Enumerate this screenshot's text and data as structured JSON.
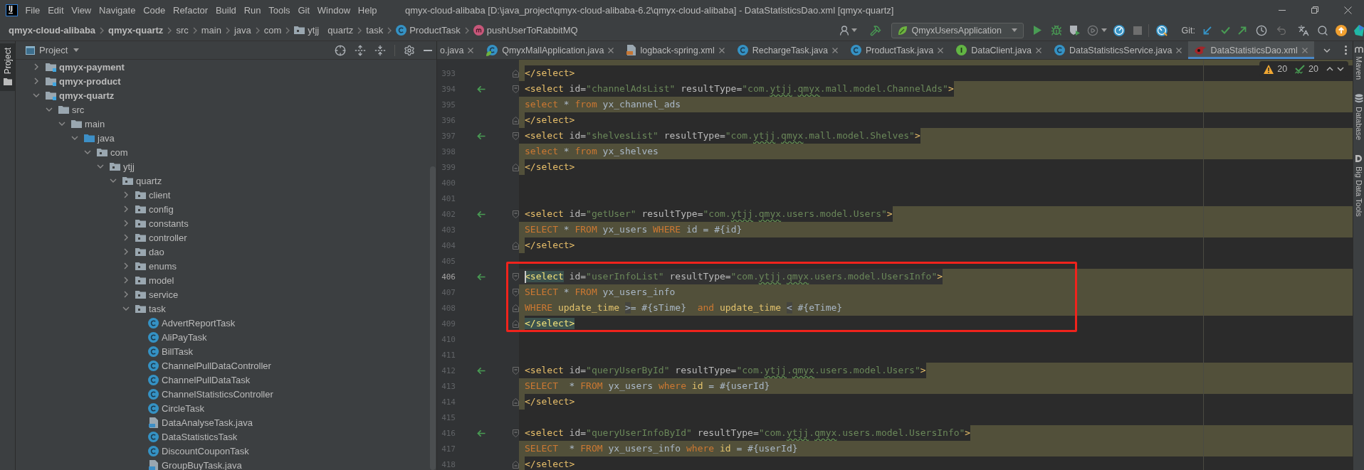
{
  "window": {
    "logo": "IJ",
    "title": "qmyx-cloud-alibaba [D:\\java_project\\qmyx-cloud-alibaba-6.2\\qmyx-cloud-alibaba] - DataStatisticsDao.xml [qmyx-quartz]"
  },
  "menu": [
    "File",
    "Edit",
    "View",
    "Navigate",
    "Code",
    "Refactor",
    "Build",
    "Run",
    "Tools",
    "Git",
    "Window",
    "Help"
  ],
  "breadcrumbs": [
    {
      "label": "qmyx-cloud-alibaba",
      "kind": "module",
      "chevron": true
    },
    {
      "label": "qmyx-quartz",
      "kind": "module",
      "chevron": true
    },
    {
      "label": "src",
      "kind": "directory",
      "chevron": true
    },
    {
      "label": "main",
      "kind": "directory",
      "chevron": true
    },
    {
      "label": "java",
      "kind": "directory",
      "chevron": true
    },
    {
      "label": "com",
      "kind": "directory",
      "chevron": true
    },
    {
      "label": "ytjj",
      "kind": "package",
      "chevron": false
    },
    {
      "label": "quartz",
      "kind": "directory",
      "chevron": true
    },
    {
      "label": "task",
      "kind": "directory",
      "chevron": true
    },
    {
      "label": "ProductTask",
      "kind": "class",
      "chevron": true
    },
    {
      "label": "pushUserToRabbitMQ",
      "kind": "method",
      "chevron": false
    }
  ],
  "toolbar": {
    "run_configuration": "QmyxUsersApplication",
    "vcs_label": "Git:"
  },
  "left_stripe": [
    {
      "label": "Project",
      "selected": true
    }
  ],
  "project": {
    "title": "Project",
    "tree": [
      {
        "label": "qmyx-payment",
        "kind": "module",
        "expanded": false
      },
      {
        "label": "qmyx-product",
        "kind": "module",
        "expanded": false
      },
      {
        "label": "qmyx-quartz",
        "kind": "module",
        "expanded": true,
        "children": [
          {
            "label": "src",
            "kind": "folder",
            "expanded": true,
            "children": [
              {
                "label": "main",
                "kind": "folder",
                "expanded": true,
                "children": [
                  {
                    "label": "java",
                    "kind": "source-root",
                    "expanded": true,
                    "children": [
                      {
                        "label": "com",
                        "kind": "package",
                        "expanded": true,
                        "children": [
                          {
                            "label": "ytjj",
                            "kind": "package",
                            "expanded": true,
                            "children": [
                              {
                                "label": "quartz",
                                "kind": "package",
                                "expanded": true,
                                "children": [
                                  {
                                    "label": "client",
                                    "kind": "package",
                                    "expanded": false
                                  },
                                  {
                                    "label": "config",
                                    "kind": "package",
                                    "expanded": false
                                  },
                                  {
                                    "label": "constants",
                                    "kind": "package",
                                    "expanded": false
                                  },
                                  {
                                    "label": "controller",
                                    "kind": "package",
                                    "expanded": false
                                  },
                                  {
                                    "label": "dao",
                                    "kind": "package",
                                    "expanded": false
                                  },
                                  {
                                    "label": "enums",
                                    "kind": "package",
                                    "expanded": false
                                  },
                                  {
                                    "label": "model",
                                    "kind": "package",
                                    "expanded": false
                                  },
                                  {
                                    "label": "service",
                                    "kind": "package",
                                    "expanded": false
                                  },
                                  {
                                    "label": "task",
                                    "kind": "package",
                                    "expanded": true,
                                    "children": [
                                      {
                                        "label": "AdvertReportTask",
                                        "kind": "class"
                                      },
                                      {
                                        "label": "AliPayTask",
                                        "kind": "class"
                                      },
                                      {
                                        "label": "BillTask",
                                        "kind": "class"
                                      },
                                      {
                                        "label": "ChannelPullDataController",
                                        "kind": "class"
                                      },
                                      {
                                        "label": "ChannelPullDataTask",
                                        "kind": "class"
                                      },
                                      {
                                        "label": "ChannelStatisticsController",
                                        "kind": "class"
                                      },
                                      {
                                        "label": "CircleTask",
                                        "kind": "class"
                                      },
                                      {
                                        "label": "DataAnalyseTask.java",
                                        "kind": "java-file"
                                      },
                                      {
                                        "label": "DataStatisticsTask",
                                        "kind": "class"
                                      },
                                      {
                                        "label": "DiscountCouponTask",
                                        "kind": "class"
                                      },
                                      {
                                        "label": "GroupBuyTask.java",
                                        "kind": "java-file"
                                      }
                                    ]
                                  }
                                ]
                              }
                            ]
                          }
                        ]
                      }
                    ]
                  }
                ]
              }
            ]
          }
        ]
      }
    ]
  },
  "editor": {
    "tabs": [
      {
        "label": "o.java",
        "kind": "plain",
        "selected": false
      },
      {
        "label": "QmyxMallApplication.java",
        "kind": "spring",
        "selected": false
      },
      {
        "label": "logback-spring.xml",
        "kind": "xml",
        "selected": false
      },
      {
        "label": "RechargeTask.java",
        "kind": "class",
        "selected": false
      },
      {
        "label": "ProductTask.java",
        "kind": "class",
        "selected": false
      },
      {
        "label": "DataClient.java",
        "kind": "interface",
        "selected": false
      },
      {
        "label": "DataStatisticsService.java",
        "kind": "class",
        "selected": false
      },
      {
        "label": "DataStatisticsDao.xml",
        "kind": "mybatis",
        "selected": true
      }
    ],
    "inspections": {
      "warnings": "20",
      "typos": "20"
    },
    "lines": [
      {
        "number": "393",
        "kind": "close",
        "fold": {
          "kind": "end"
        },
        "nav_marker": false,
        "current": false,
        "tokens": [
          {
            "text": " </select>",
            "kind": "tag"
          }
        ]
      },
      {
        "number": "394",
        "kind": "open",
        "fold": {
          "kind": "start"
        },
        "nav_marker": true,
        "current": false,
        "tokens": [
          {
            "text": "<select",
            "kind": "tag"
          },
          {
            "text": " id=",
            "kind": "attr"
          },
          {
            "text": "\"channelAdsList\"",
            "kind": "value"
          },
          {
            "text": " resultType=",
            "kind": "attr"
          },
          {
            "text": "\"com.",
            "kind": "value"
          },
          {
            "text": "ytjj",
            "kind": "value-typo"
          },
          {
            "text": ".",
            "kind": "value"
          },
          {
            "text": "qmyx",
            "kind": "value-typo"
          },
          {
            "text": ".mall.model.ChannelAds\"",
            "kind": "value"
          },
          {
            "text": ">",
            "kind": "tag"
          }
        ]
      },
      {
        "number": "395",
        "kind": "body",
        "nav_marker": false,
        "current": false,
        "tokens": [
          {
            "text": "   select",
            "kind": "keyword"
          },
          {
            "text": " * ",
            "kind": "plain"
          },
          {
            "text": "from",
            "kind": "keyword"
          },
          {
            "text": " yx_channel_ads",
            "kind": "plain"
          }
        ]
      },
      {
        "number": "396",
        "kind": "close",
        "fold": {
          "kind": "end"
        },
        "nav_marker": false,
        "current": false,
        "tokens": [
          {
            "text": " </select>",
            "kind": "tag"
          }
        ]
      },
      {
        "number": "397",
        "kind": "open",
        "fold": {
          "kind": "start"
        },
        "nav_marker": true,
        "current": false,
        "tokens": [
          {
            "text": " <select",
            "kind": "tag"
          },
          {
            "text": " id=",
            "kind": "attr"
          },
          {
            "text": "\"shelvesList\"",
            "kind": "value"
          },
          {
            "text": " resultType=",
            "kind": "attr"
          },
          {
            "text": "\"com.",
            "kind": "value"
          },
          {
            "text": "ytjj",
            "kind": "value-typo"
          },
          {
            "text": ".",
            "kind": "value"
          },
          {
            "text": "qmyx",
            "kind": "value-typo"
          },
          {
            "text": ".mall.model.Shelves\"",
            "kind": "value"
          },
          {
            "text": ">",
            "kind": "tag"
          }
        ]
      },
      {
        "number": "398",
        "kind": "body",
        "nav_marker": false,
        "current": false,
        "tokens": [
          {
            "text": "   select",
            "kind": "keyword"
          },
          {
            "text": " * ",
            "kind": "plain"
          },
          {
            "text": "from",
            "kind": "keyword"
          },
          {
            "text": " yx_shelves",
            "kind": "plain"
          }
        ]
      },
      {
        "number": "399",
        "kind": "close",
        "fold": {
          "kind": "end"
        },
        "nav_marker": false,
        "current": false,
        "tokens": [
          {
            "text": " </select>",
            "kind": "tag"
          }
        ]
      },
      {
        "number": "400",
        "kind": "blank",
        "nav_marker": false,
        "current": false
      },
      {
        "number": "401",
        "kind": "blank",
        "nav_marker": false,
        "current": false
      },
      {
        "number": "402",
        "kind": "open",
        "fold": {
          "kind": "start"
        },
        "nav_marker": true,
        "current": false,
        "tokens": [
          {
            "text": " <select",
            "kind": "tag"
          },
          {
            "text": " id=",
            "kind": "attr"
          },
          {
            "text": "\"getUser\"",
            "kind": "value"
          },
          {
            "text": " resultType=",
            "kind": "attr"
          },
          {
            "text": "\"com.",
            "kind": "value"
          },
          {
            "text": "ytjj",
            "kind": "value-typo"
          },
          {
            "text": ".",
            "kind": "value"
          },
          {
            "text": "qmyx",
            "kind": "value-typo"
          },
          {
            "text": ".users.model.Users\"",
            "kind": "value"
          },
          {
            "text": ">",
            "kind": "tag"
          }
        ]
      },
      {
        "number": "403",
        "kind": "body",
        "nav_marker": false,
        "current": false,
        "tokens": [
          {
            "text": "   SELECT",
            "kind": "keyword"
          },
          {
            "text": " * ",
            "kind": "plain"
          },
          {
            "text": "FROM",
            "kind": "keyword"
          },
          {
            "text": " yx_users ",
            "kind": "plain"
          },
          {
            "text": "WHERE",
            "kind": "keyword"
          },
          {
            "text": " id = #{id}",
            "kind": "plain"
          }
        ]
      },
      {
        "number": "404",
        "kind": "close",
        "fold": {
          "kind": "end"
        },
        "nav_marker": false,
        "current": false,
        "tokens": [
          {
            "text": " </select>",
            "kind": "tag"
          }
        ]
      },
      {
        "number": "405",
        "kind": "blank",
        "nav_marker": false,
        "current": false
      },
      {
        "number": "406",
        "kind": "open",
        "fold": {
          "kind": "start"
        },
        "nav_marker": true,
        "current": true,
        "tokens": [
          {
            "text": " <select",
            "kind": "tag-matched"
          },
          {
            "text": " id=",
            "kind": "attr"
          },
          {
            "text": "\"userInfoList\"",
            "kind": "value"
          },
          {
            "text": " resultType=",
            "kind": "attr"
          },
          {
            "text": "\"com.",
            "kind": "value"
          },
          {
            "text": "ytjj",
            "kind": "value-typo"
          },
          {
            "text": ".",
            "kind": "value"
          },
          {
            "text": "qmyx",
            "kind": "value-typo"
          },
          {
            "text": ".users.model.UsersInfo\"",
            "kind": "value"
          },
          {
            "text": ">",
            "kind": "tag"
          }
        ]
      },
      {
        "number": "407",
        "kind": "body",
        "fold": {
          "kind": "start"
        },
        "nav_marker": false,
        "current": false,
        "tokens": [
          {
            "text": "   SELECT",
            "kind": "keyword"
          },
          {
            "text": " * ",
            "kind": "plain"
          },
          {
            "text": "FROM",
            "kind": "keyword"
          },
          {
            "text": " yx_users_info",
            "kind": "plain"
          }
        ]
      },
      {
        "number": "408",
        "kind": "body",
        "fold": {
          "kind": "end"
        },
        "nav_marker": false,
        "current": false,
        "tokens": [
          {
            "text": "    WHERE",
            "kind": "keyword"
          },
          {
            "text": " update_time ",
            "kind": "column"
          },
          {
            "text": ">",
            "kind": "operator-flagged"
          },
          {
            "text": "= #{sTime}  ",
            "kind": "plain"
          },
          {
            "text": "and",
            "kind": "keyword"
          },
          {
            "text": " update_time ",
            "kind": "column"
          },
          {
            "text": "<",
            "kind": "operator-flagged"
          },
          {
            "text": " #{eTime}",
            "kind": "plain"
          }
        ]
      },
      {
        "number": "409",
        "kind": "close",
        "fold": {
          "kind": "end"
        },
        "nav_marker": false,
        "current": false,
        "tokens": [
          {
            "text": " </select>",
            "kind": "tag-matched"
          }
        ]
      },
      {
        "number": "410",
        "kind": "blank",
        "nav_marker": false,
        "current": false
      },
      {
        "number": "411",
        "kind": "blank",
        "nav_marker": false,
        "current": false
      },
      {
        "number": "412",
        "kind": "open",
        "fold": {
          "kind": "start"
        },
        "nav_marker": true,
        "current": false,
        "tokens": [
          {
            "text": " <select",
            "kind": "tag"
          },
          {
            "text": " id=",
            "kind": "attr"
          },
          {
            "text": "\"queryUserById\"",
            "kind": "value"
          },
          {
            "text": " resultType=",
            "kind": "attr"
          },
          {
            "text": "\"com.",
            "kind": "value"
          },
          {
            "text": "ytjj",
            "kind": "value-typo"
          },
          {
            "text": ".",
            "kind": "value"
          },
          {
            "text": "qmyx",
            "kind": "value-typo"
          },
          {
            "text": ".users.model.Users\"",
            "kind": "value"
          },
          {
            "text": ">",
            "kind": "tag"
          }
        ]
      },
      {
        "number": "413",
        "kind": "body",
        "nav_marker": false,
        "current": false,
        "tokens": [
          {
            "text": "   SELECT",
            "kind": "keyword"
          },
          {
            "text": "  * ",
            "kind": "plain"
          },
          {
            "text": "FROM",
            "kind": "keyword"
          },
          {
            "text": " yx_users ",
            "kind": "plain"
          },
          {
            "text": "where",
            "kind": "keyword"
          },
          {
            "text": " id",
            "kind": "column"
          },
          {
            "text": " = #{userId}",
            "kind": "plain"
          }
        ]
      },
      {
        "number": "414",
        "kind": "close",
        "fold": {
          "kind": "end"
        },
        "nav_marker": false,
        "current": false,
        "tokens": [
          {
            "text": " </select>",
            "kind": "tag"
          }
        ]
      },
      {
        "number": "415",
        "kind": "blank",
        "nav_marker": false,
        "current": false
      },
      {
        "number": "416",
        "kind": "open",
        "fold": {
          "kind": "start"
        },
        "nav_marker": true,
        "current": false,
        "tokens": [
          {
            "text": " <select",
            "kind": "tag"
          },
          {
            "text": " id=",
            "kind": "attr"
          },
          {
            "text": "\"queryUserInfoById\"",
            "kind": "value"
          },
          {
            "text": " resultType=",
            "kind": "attr"
          },
          {
            "text": "\"com.",
            "kind": "value"
          },
          {
            "text": "ytjj",
            "kind": "value-typo"
          },
          {
            "text": ".",
            "kind": "value"
          },
          {
            "text": "qmyx",
            "kind": "value-typo"
          },
          {
            "text": ".users.model.UsersInfo\"",
            "kind": "value"
          },
          {
            "text": ">",
            "kind": "tag"
          }
        ]
      },
      {
        "number": "417",
        "kind": "body",
        "nav_marker": false,
        "current": false,
        "tokens": [
          {
            "text": "   SELECT",
            "kind": "keyword"
          },
          {
            "text": "  * ",
            "kind": "plain"
          },
          {
            "text": "FROM",
            "kind": "keyword"
          },
          {
            "text": " yx_users_info ",
            "kind": "plain"
          },
          {
            "text": "where",
            "kind": "keyword"
          },
          {
            "text": " id",
            "kind": "column"
          },
          {
            "text": " = #{userId}",
            "kind": "plain"
          }
        ]
      },
      {
        "number": "418",
        "kind": "close",
        "fold": {
          "kind": "end"
        },
        "nav_marker": false,
        "current": false,
        "tokens": [
          {
            "text": " </select>",
            "kind": "tag"
          }
        ]
      }
    ]
  },
  "right_stripe": [
    {
      "label": "Maven",
      "kind": "maven",
      "selected": false
    },
    {
      "label": "Database",
      "kind": "database",
      "selected": false
    },
    {
      "label": "Big Data Tools",
      "kind": "bigdata",
      "selected": false
    }
  ]
}
